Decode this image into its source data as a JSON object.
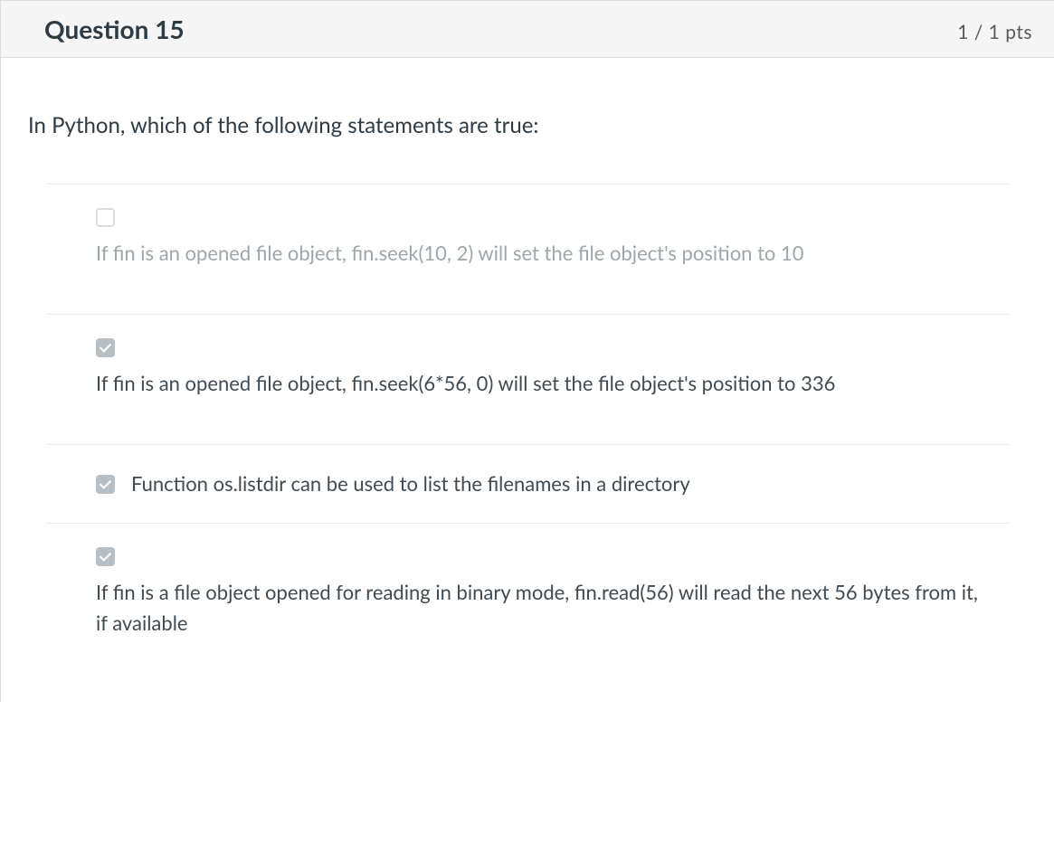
{
  "header": {
    "title": "Question 15",
    "points": "1 / 1 pts"
  },
  "prompt": "In Python, which of the following statements are true:",
  "answers": [
    {
      "checked": false,
      "dim": true,
      "layout": "stacked",
      "compact": false,
      "text": "If fin is an opened file object, fin.seek(10, 2) will set the file object's position to 10"
    },
    {
      "checked": true,
      "dim": false,
      "layout": "stacked",
      "compact": false,
      "text": "If fin is an opened file object, fin.seek(6*56, 0) will set the file object's position to 336"
    },
    {
      "checked": true,
      "dim": false,
      "layout": "inline",
      "compact": true,
      "text": "Function os.listdir can be used to list the filenames in a directory"
    },
    {
      "checked": true,
      "dim": false,
      "layout": "stacked",
      "compact": false,
      "text": "If fin is a file object opened for reading in binary mode, fin.read(56) will read the next 56 bytes from it, if available"
    }
  ]
}
